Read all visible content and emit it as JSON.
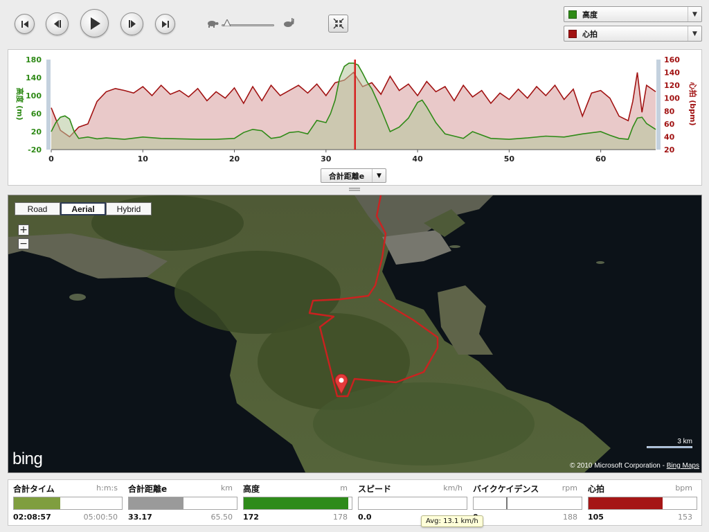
{
  "toolbar": {
    "buttons": [
      "skip-to-start",
      "step-back",
      "play",
      "step-forward",
      "skip-to-end"
    ],
    "speed": {
      "slow_icon": "turtle-icon",
      "fast_icon": "rabbit-icon",
      "level": 0.05
    },
    "fit_icon": "collapse-arrows-icon"
  },
  "series_selectors": [
    {
      "label": "高度",
      "color": "#2f8a17"
    },
    {
      "label": "心拍",
      "color": "#a11212"
    }
  ],
  "chart": {
    "x_axis_selector": "合計距離e",
    "left_axis_label": "高度 (m)",
    "right_axis_label": "心拍 (bpm)"
  },
  "chart_data": {
    "type": "area",
    "xlabel": "合計距離e",
    "ylabel": "高度 (m)",
    "y2label": "心拍 (bpm)",
    "xlim": [
      0,
      66
    ],
    "ylim": [
      -20,
      180
    ],
    "y2lim": [
      20,
      160
    ],
    "x_ticks": [
      0,
      10,
      20,
      30,
      40,
      50,
      60
    ],
    "y_ticks": [
      -20,
      20,
      60,
      100,
      140,
      180
    ],
    "y2_ticks": [
      20,
      40,
      60,
      80,
      100,
      120,
      140,
      160
    ],
    "cursor_x": 33.17,
    "grid": false,
    "series": [
      {
        "name": "高度",
        "axis": "left",
        "color": "#2f8a17",
        "x": [
          0,
          0.5,
          1,
          1.5,
          2,
          2.5,
          3,
          4,
          5,
          6,
          8,
          10,
          12,
          14,
          16,
          18,
          20,
          21,
          22,
          23,
          24,
          25,
          26,
          27,
          28,
          29,
          30,
          30.5,
          31,
          31.5,
          32,
          32.5,
          33,
          33.5,
          34,
          34.5,
          35,
          36,
          37,
          38,
          39,
          40,
          40.5,
          41,
          42,
          43,
          44,
          45,
          46,
          48,
          50,
          52,
          54,
          56,
          58,
          60,
          61,
          62,
          63,
          63.5,
          64,
          64.5,
          65,
          66
        ],
        "y": [
          20,
          40,
          52,
          55,
          48,
          20,
          5,
          8,
          4,
          6,
          3,
          8,
          5,
          4,
          3,
          3,
          5,
          18,
          25,
          22,
          5,
          8,
          18,
          20,
          15,
          45,
          40,
          60,
          90,
          140,
          165,
          172,
          172,
          168,
          150,
          130,
          115,
          70,
          20,
          30,
          50,
          85,
          90,
          75,
          40,
          15,
          10,
          5,
          20,
          5,
          3,
          6,
          10,
          8,
          15,
          20,
          12,
          5,
          3,
          30,
          50,
          52,
          38,
          25
        ]
      },
      {
        "name": "心拍",
        "axis": "right",
        "color": "#a11212",
        "x": [
          0,
          1,
          2,
          3,
          4,
          5,
          6,
          7,
          8,
          9,
          10,
          11,
          12,
          13,
          14,
          15,
          16,
          17,
          18,
          19,
          20,
          21,
          22,
          23,
          24,
          25,
          26,
          27,
          28,
          29,
          30,
          31,
          32,
          33,
          34,
          35,
          36,
          37,
          38,
          39,
          40,
          41,
          42,
          43,
          44,
          45,
          46,
          47,
          48,
          49,
          50,
          51,
          52,
          53,
          54,
          55,
          56,
          57,
          58,
          59,
          60,
          61,
          62,
          63,
          63.5,
          64,
          64.5,
          65,
          66
        ],
        "y": [
          85,
          50,
          40,
          55,
          60,
          95,
          110,
          115,
          112,
          108,
          118,
          104,
          120,
          106,
          112,
          102,
          115,
          96,
          110,
          100,
          116,
          92,
          118,
          96,
          120,
          104,
          112,
          120,
          108,
          122,
          104,
          124,
          128,
          140,
          118,
          124,
          106,
          134,
          112,
          122,
          104,
          126,
          110,
          118,
          96,
          120,
          102,
          112,
          92,
          108,
          98,
          114,
          100,
          118,
          104,
          120,
          98,
          114,
          72,
          108,
          112,
          100,
          72,
          65,
          95,
          140,
          78,
          120,
          110
        ]
      }
    ]
  },
  "map": {
    "types": [
      "Road",
      "Aerial",
      "Hybrid"
    ],
    "active_type": "Aerial",
    "zoom_in": "+",
    "zoom_out": "−",
    "logo": "bing",
    "scale_label": "3 km",
    "copyright": "© 2010 Microsoft Corporation -",
    "copyright_link": "Bing Maps",
    "marker_icon": "map-pin-icon"
  },
  "stats": [
    {
      "name": "合計タイム",
      "unit": "h:m:s",
      "value": "02:08:57",
      "max": "05:00:50",
      "fraction": 0.43,
      "color": "#7f9e3f"
    },
    {
      "name": "合計距離e",
      "unit": "km",
      "value": "33.17",
      "max": "65.50",
      "fraction": 0.506,
      "color": "#9a9a9a"
    },
    {
      "name": "高度",
      "unit": "m",
      "value": "172",
      "max": "178",
      "fraction": 0.966,
      "color": "#2e8b1a"
    },
    {
      "name": "スピード",
      "unit": "km/h",
      "value": "0.0",
      "max": "",
      "fraction": 0.0,
      "color": "#cccccc"
    },
    {
      "name": "バイクケイデンス",
      "unit": "rpm",
      "value": "0",
      "max": "188",
      "fraction": 0.0,
      "marker": 0.3,
      "color": "#cccccc"
    },
    {
      "name": "心拍",
      "unit": "bpm",
      "value": "105",
      "max": "153",
      "fraction": 0.686,
      "color": "#a51616"
    }
  ],
  "tooltip": "Avg: 13.1 km/h"
}
